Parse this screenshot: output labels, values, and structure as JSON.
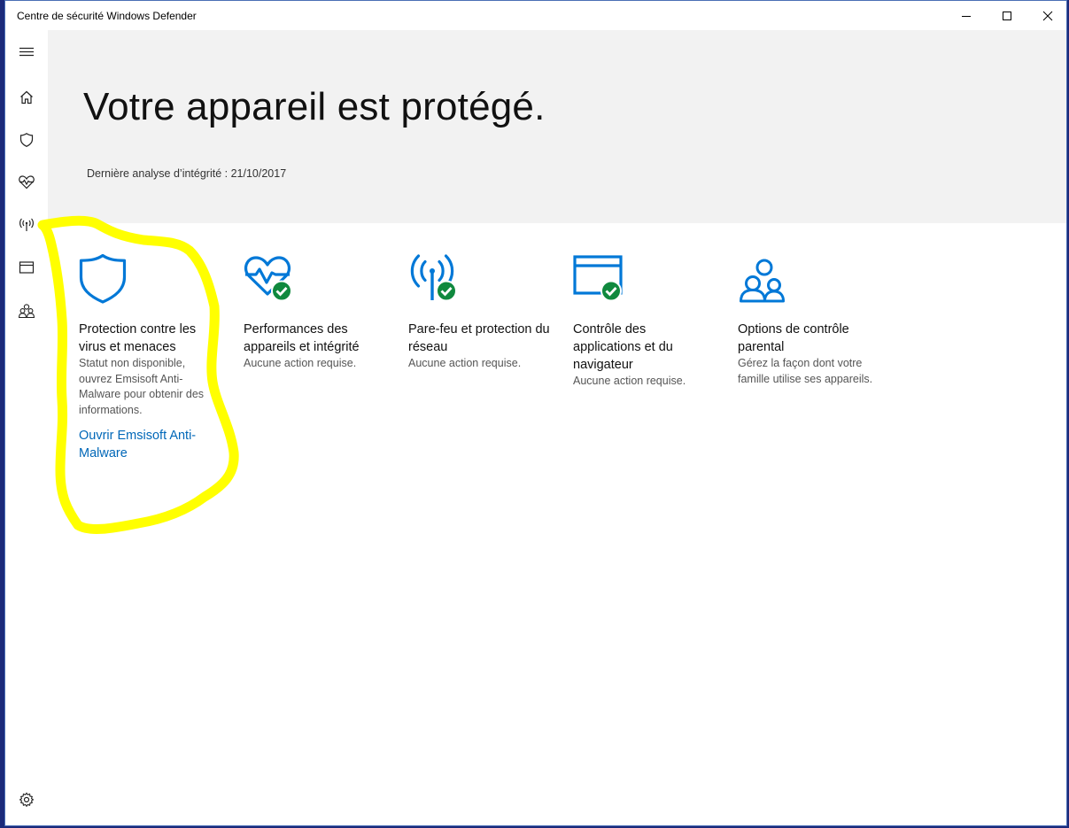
{
  "window": {
    "title": "Centre de sécurité Windows Defender",
    "buttons": [
      "minimize",
      "maximize",
      "close"
    ]
  },
  "sidebar": {
    "items": [
      {
        "icon": "hamburger-menu-icon"
      },
      {
        "icon": "home-icon"
      },
      {
        "icon": "shield-icon"
      },
      {
        "icon": "heart-pulse-icon"
      },
      {
        "icon": "wireless-signal-icon"
      },
      {
        "icon": "browser-window-icon"
      },
      {
        "icon": "family-icon"
      },
      {
        "icon": "gear-icon"
      }
    ]
  },
  "hero": {
    "title": "Votre appareil est protégé.",
    "subtitle": "Dernière analyse d’intégrité : 21/10/2017"
  },
  "tiles": [
    {
      "icon": "shield-icon",
      "title": "Protection contre les virus et menaces",
      "description": "Statut non disponible, ouvrez Emsisoft Anti-Malware pour obtenir des informations.",
      "link": "Ouvrir Emsisoft Anti-Malware"
    },
    {
      "icon": "heart-pulse-icon",
      "title": "Performances des appareils et intégrité",
      "description": "Aucune action requise."
    },
    {
      "icon": "wireless-signal-icon",
      "title": "Pare-feu et protection du réseau",
      "description": "Aucune action requise."
    },
    {
      "icon": "browser-window-icon",
      "title": "Contrôle des applications et du navigateur",
      "description": "Aucune action requise."
    },
    {
      "icon": "family-icon",
      "title": "Options de contrôle parental",
      "description": "Gérez la façon dont votre famille utilise ses appareils."
    }
  ],
  "colors": {
    "accent": "#0078d7",
    "link": "#0067b8",
    "ok": "#10893e",
    "hero_bg": "#f2f2f2",
    "annotation": "#ffff00"
  }
}
